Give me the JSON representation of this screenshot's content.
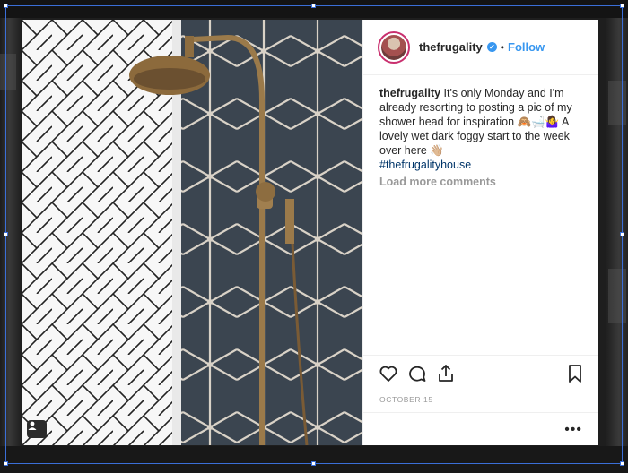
{
  "post": {
    "username": "thefrugality",
    "verified_mark": "✔",
    "separator": "•",
    "follow_label": "Follow",
    "caption_text": "It's only Monday and I'm already resorting to posting a pic of my shower head for inspiration 🙈🛁🤷‍♀️ A lovely wet dark foggy start to the week over here 👋🏼",
    "hashtag": "#thefrugalityhouse",
    "load_more": "Load more comments",
    "date": "OCTOBER 15",
    "more_options": "•••"
  },
  "icons": {
    "like": "heart-icon",
    "comment": "comment-icon",
    "share": "share-icon",
    "save": "bookmark-icon",
    "user_tags": "user-tag-icon"
  },
  "colors": {
    "link": "#3897f0",
    "hashtag": "#003569",
    "muted": "#999999",
    "selection_frame": "#3b6fd8"
  }
}
